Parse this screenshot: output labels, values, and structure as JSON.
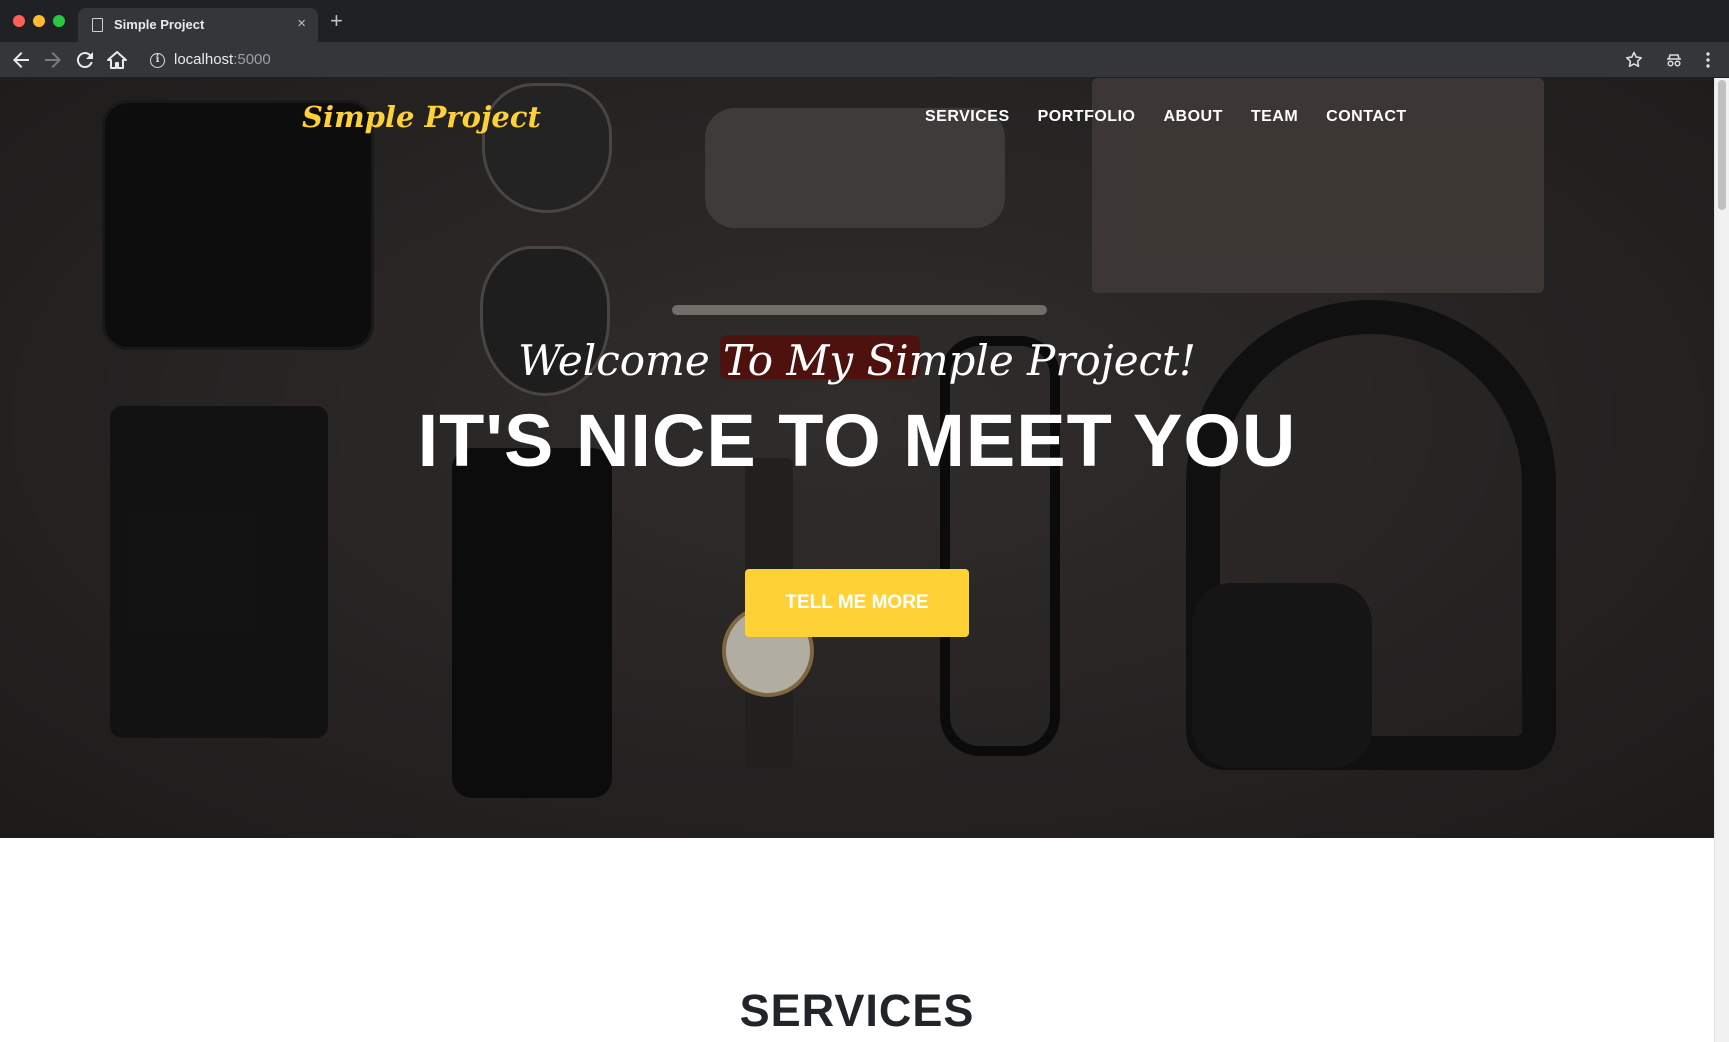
{
  "browser": {
    "tab_title": "Simple Project",
    "tab_close": "×",
    "new_tab": "+",
    "url_host": "localhost",
    "url_port": ":5000",
    "info_icon": "i"
  },
  "site": {
    "brand": "Simple Project",
    "nav": [
      "SERVICES",
      "PORTFOLIO",
      "ABOUT",
      "TEAM",
      "CONTACT"
    ],
    "hero": {
      "lead": "Welcome To My Simple Project!",
      "heading": "IT'S NICE TO MEET YOU",
      "cta": "TELL ME MORE"
    },
    "section_title": "SERVICES"
  },
  "colors": {
    "accent": "#fed136",
    "chrome_dark": "#202124",
    "chrome_toolbar": "#35363a",
    "text_dark": "#212529"
  }
}
